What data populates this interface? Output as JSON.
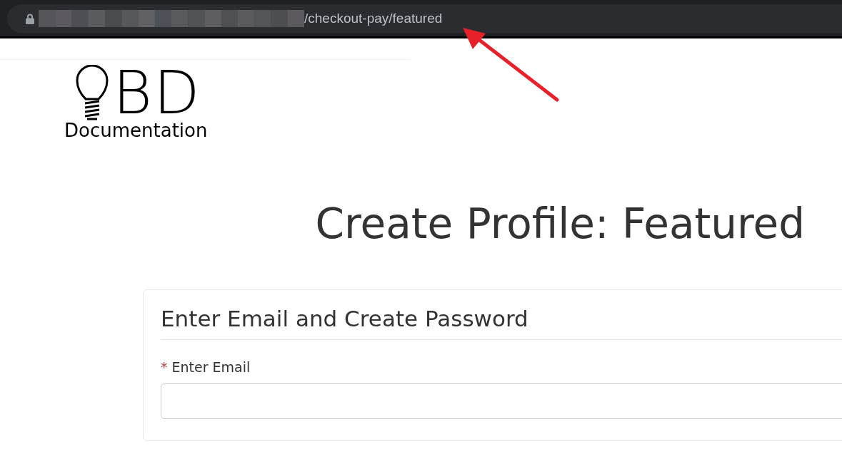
{
  "address_bar": {
    "url_path": "/checkout-pay/featured"
  },
  "logo": {
    "letters": "BD",
    "subtitle": "Documentation"
  },
  "heading": "Create Profile: Featured",
  "card": {
    "title": "Enter Email and Create Password",
    "fields": [
      {
        "label": "Enter Email",
        "required": true,
        "required_marker": "*"
      }
    ]
  }
}
